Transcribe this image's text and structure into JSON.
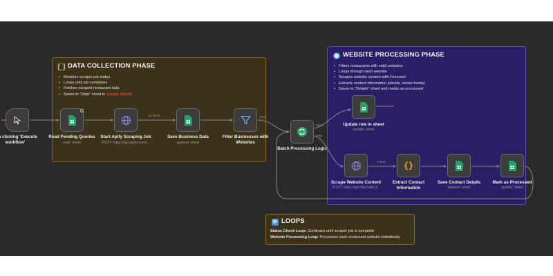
{
  "canvas": {
    "background": "#2a2a2a"
  },
  "stickies": {
    "data_collection": {
      "title": "DATA COLLECTION PHASE",
      "icon": "bar-chart-icon",
      "bullets": [
        "Monitors scraper job status",
        "Loops until job completes",
        "Fetches scraped restaurant data"
      ],
      "last_bullet_prefix": "Saves to \"Data\" sheet in ",
      "last_bullet_link": "Google Sheets"
    },
    "website_processing": {
      "title": "WEBSITE PROCESSING PHASE",
      "icon": "globe-icon",
      "bullets": [
        "Filters restaurants with valid websites",
        "Loops through each website",
        "Scrapes website content with Firecrawl",
        "Extracts contact information (emails, social media)",
        "Saves to \"Details\" sheet and marks as processed"
      ]
    },
    "loops": {
      "title": "LOOPS",
      "icon": "repeat-icon",
      "line1_bold": "Status Check Loop:",
      "line1_text": " Continues until scraper job is complete",
      "line2_bold": "Website Processing Loop:",
      "line2_text": " Processes each restaurant website individually"
    }
  },
  "nodes": {
    "trigger": {
      "label": "hen clicking 'Execute workflow'",
      "icon": "cursor-icon"
    },
    "read_pending": {
      "label": "Read Pending Queries",
      "sub": "read: sheet",
      "icon": "google-sheets-icon"
    },
    "start_apify": {
      "label": "Start Apify Scraping Job",
      "sub": "POST: https://api.apify.com/v...",
      "icon": "globe-icon"
    },
    "save_business": {
      "label": "Save Business Data",
      "sub": "append: sheet",
      "icon": "google-sheets-icon"
    },
    "filter": {
      "label": "Filter Businesses with Websites",
      "icon": "filter-icon"
    },
    "batch": {
      "label": "Batch Processing Logic",
      "icon": "loop-icon",
      "out_done": "done",
      "out_loop": "loop"
    },
    "update_row": {
      "label": "Update row in sheet",
      "sub": "update: sheet",
      "icon": "google-sheets-icon"
    },
    "scrape_website": {
      "label": "Scrape Website Content",
      "sub": "POST: https://api.firecrawl.d...",
      "icon": "globe-icon"
    },
    "extract_contact": {
      "label": "Extract Contact Information",
      "icon": "code-braces-icon"
    },
    "save_contact": {
      "label": "Save Contact Details",
      "sub": "append: sheet",
      "icon": "google-sheets-icon"
    },
    "mark_processed": {
      "label": "Mark as Processed",
      "sub": "update: sheet",
      "icon": "google-sheets-icon"
    }
  },
  "connections": {
    "apify_to_save": "10 items",
    "filter_to_batch": "True",
    "scrape_to_extract": "1 item"
  },
  "colors": {
    "sheets_green": "#1fa463",
    "node_bg": "#3c3c3c",
    "wire": "#8a8a8a",
    "trigger_accent": "#ff6d5a",
    "data_sticky": "#3b321a",
    "web_sticky": "#2a1f66"
  }
}
